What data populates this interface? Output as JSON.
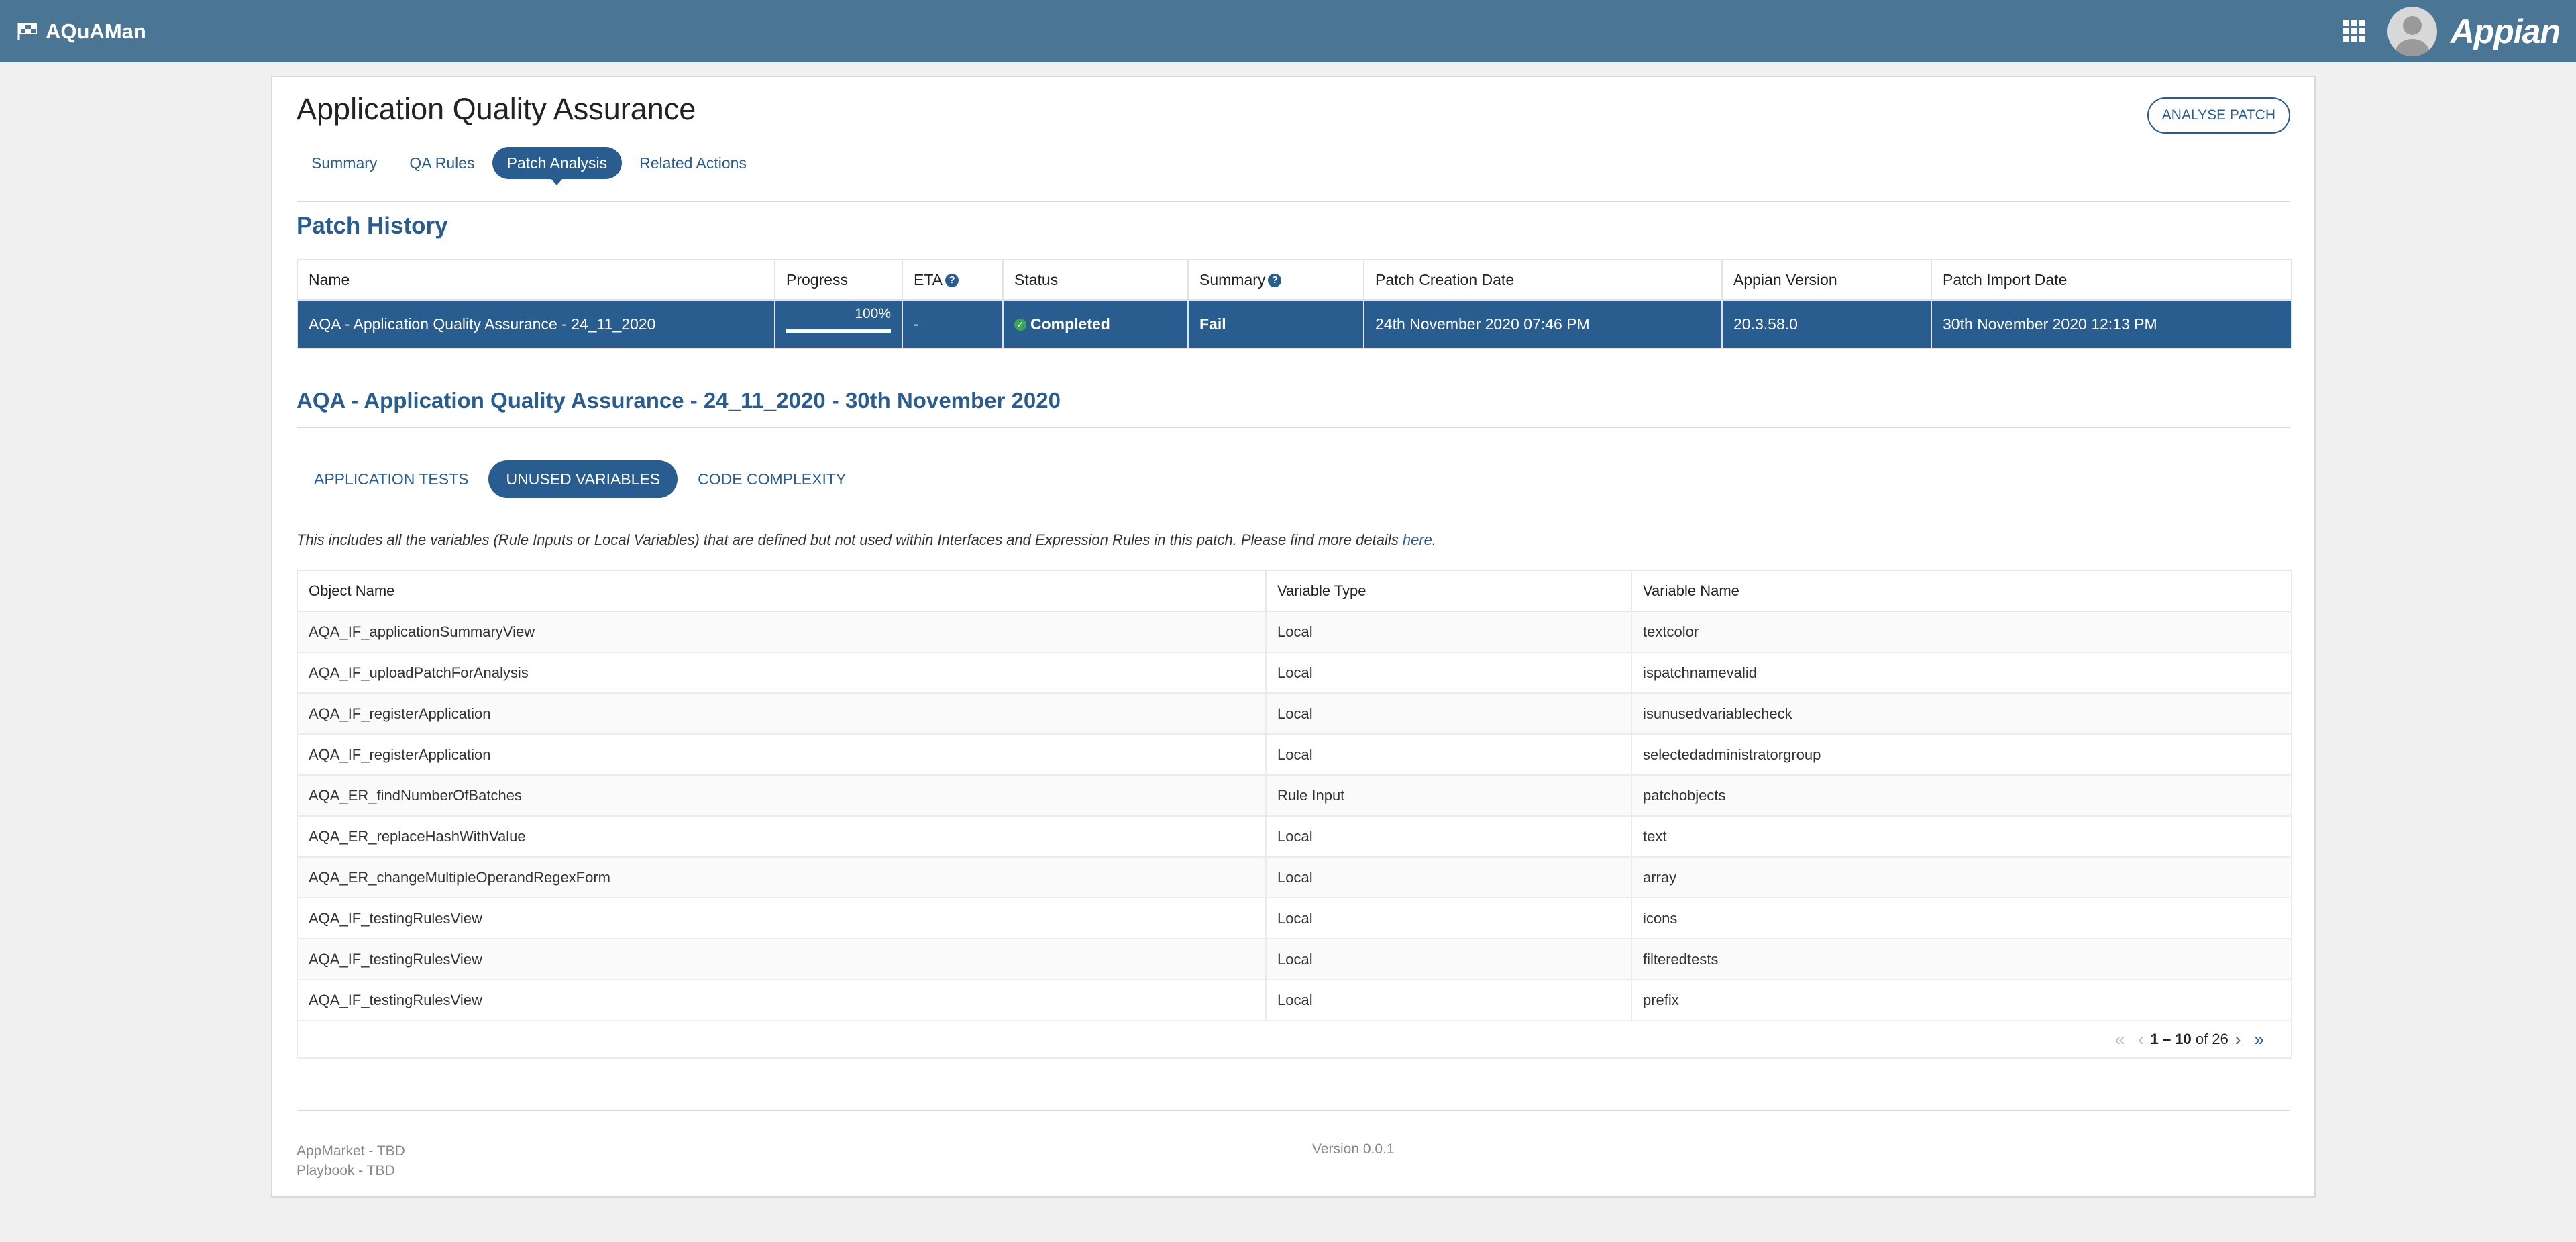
{
  "topbar": {
    "app_name": "AQuAMan",
    "logo_text": "Appian"
  },
  "page": {
    "title": "Application Quality Assurance",
    "tabs": [
      "Summary",
      "QA Rules",
      "Patch Analysis",
      "Related Actions"
    ],
    "active_tab": "Patch Analysis",
    "analyse_button": "ANALYSE PATCH"
  },
  "patch_history": {
    "title": "Patch History",
    "headers": {
      "name": "Name",
      "progress": "Progress",
      "eta": "ETA",
      "status": "Status",
      "summary": "Summary",
      "created": "Patch Creation Date",
      "version": "Appian Version",
      "imported": "Patch Import Date"
    },
    "row": {
      "name": "AQA - Application Quality Assurance - 24_11_2020",
      "progress_label": "100%",
      "progress_value": 100,
      "eta": "-",
      "status": "Completed",
      "summary": "Fail",
      "created": "24th November 2020 07:46 PM",
      "version": "20.3.58.0",
      "imported": "30th November 2020 12:13 PM"
    }
  },
  "analysis": {
    "title": "AQA - Application Quality Assurance - 24_11_2020 - 30th November 2020",
    "subtabs": [
      "APPLICATION TESTS",
      "UNUSED VARIABLES",
      "CODE COMPLEXITY"
    ],
    "active_subtab": "UNUSED VARIABLES",
    "description": "This includes all the variables (Rule Inputs or Local Variables) that are defined but not used within Interfaces and Expression Rules in this patch. Please find more details ",
    "description_link": "here",
    "description_end": ".",
    "headers": {
      "object": "Object Name",
      "type": "Variable Type",
      "name": "Variable Name"
    },
    "rows": [
      {
        "object": "AQA_IF_applicationSummaryView",
        "type": "Local",
        "name": "textcolor"
      },
      {
        "object": "AQA_IF_uploadPatchForAnalysis",
        "type": "Local",
        "name": "ispatchnamevalid"
      },
      {
        "object": "AQA_IF_registerApplication",
        "type": "Local",
        "name": "isunusedvariablecheck"
      },
      {
        "object": "AQA_IF_registerApplication",
        "type": "Local",
        "name": "selectedadministratorgroup"
      },
      {
        "object": "AQA_ER_findNumberOfBatches",
        "type": "Rule Input",
        "name": "patchobjects"
      },
      {
        "object": "AQA_ER_replaceHashWithValue",
        "type": "Local",
        "name": "text"
      },
      {
        "object": "AQA_ER_changeMultipleOperandRegexForm",
        "type": "Local",
        "name": "array"
      },
      {
        "object": "AQA_IF_testingRulesView",
        "type": "Local",
        "name": "icons"
      },
      {
        "object": "AQA_IF_testingRulesView",
        "type": "Local",
        "name": "filteredtests"
      },
      {
        "object": "AQA_IF_testingRulesView",
        "type": "Local",
        "name": "prefix"
      }
    ],
    "pager": {
      "range": "1 – 10",
      "of_text": "of 26"
    }
  },
  "footer": {
    "links": [
      "AppMarket - TBD",
      "Playbook - TBD"
    ],
    "version": "Version 0.0.1"
  },
  "colors": {
    "topbar": "#4a7594",
    "accent": "#2a5d8f",
    "success": "#3aa35a"
  }
}
